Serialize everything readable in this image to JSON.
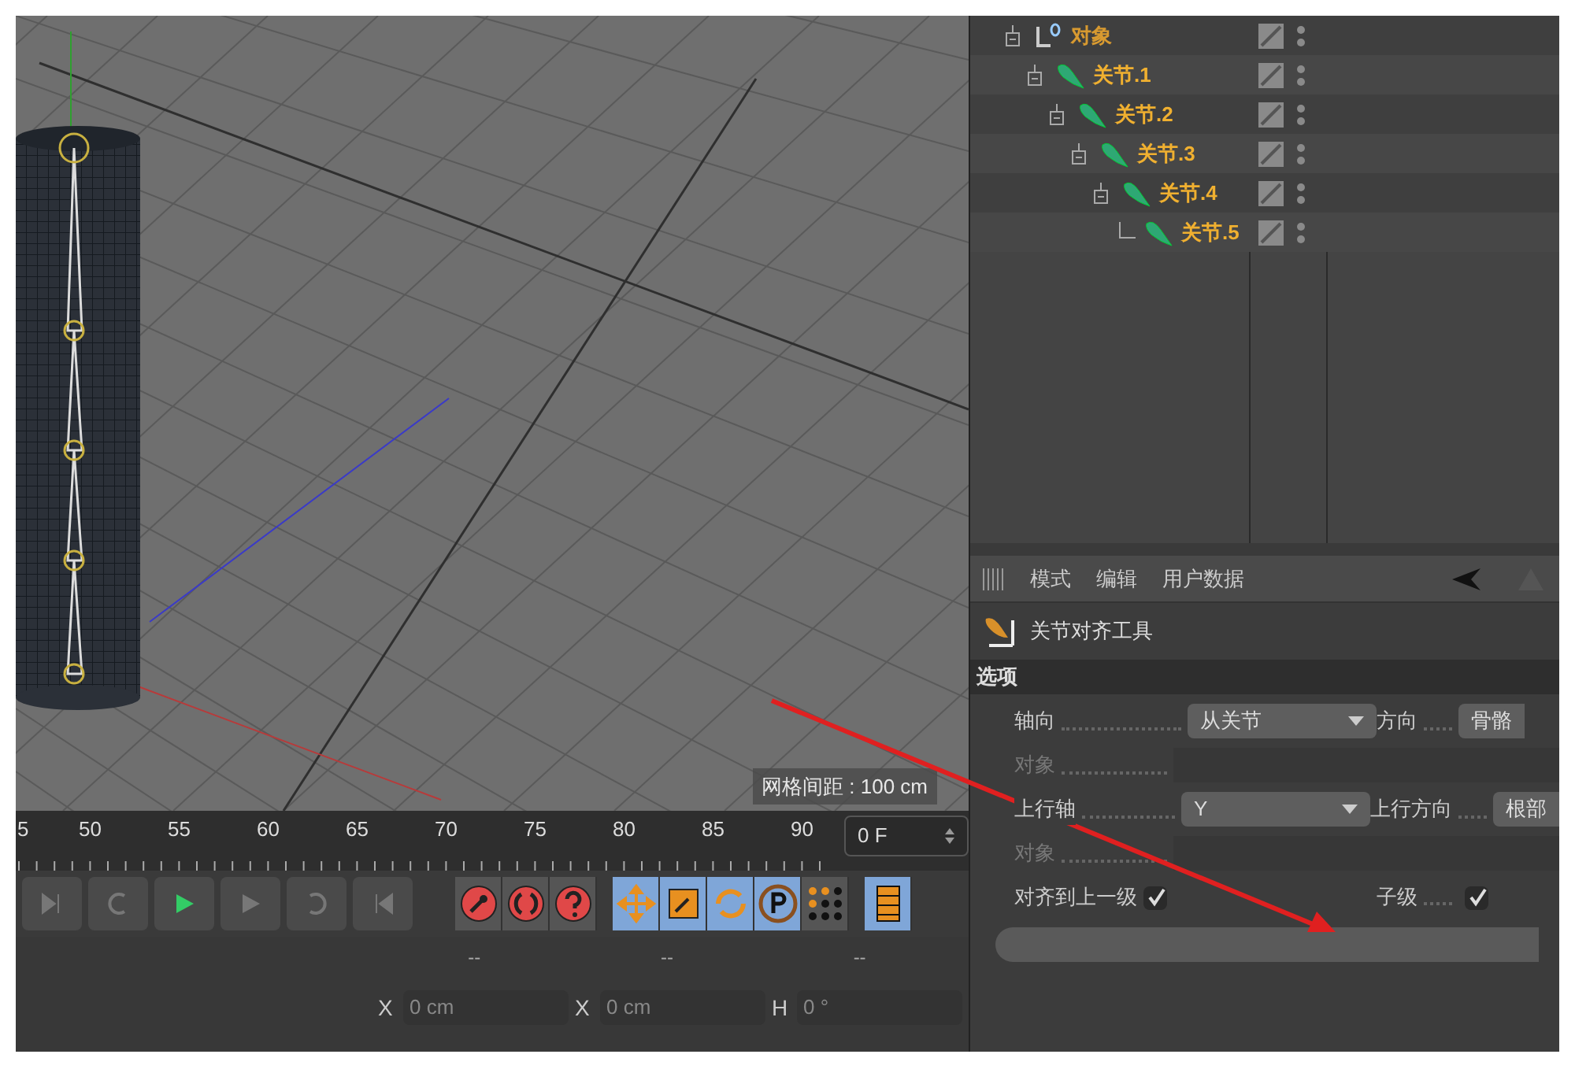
{
  "viewport": {
    "grid_label": "网格间距 : 100 cm"
  },
  "timeline": {
    "ticks": [
      "5",
      "50",
      "55",
      "60",
      "65",
      "70",
      "75",
      "80",
      "85",
      "90"
    ],
    "frame": "0 F"
  },
  "toolbar": [
    {
      "kind": "key",
      "selected": false
    },
    {
      "kind": "cycle",
      "selected": false
    },
    {
      "kind": "help",
      "selected": false
    },
    {
      "kind": "move",
      "selected": true
    },
    {
      "kind": "scale",
      "selected": true
    },
    {
      "kind": "rotate",
      "selected": true
    },
    {
      "kind": "param",
      "selected": true
    },
    {
      "kind": "points",
      "selected": false
    },
    {
      "kind": "film",
      "selected": true
    }
  ],
  "coordinates": {
    "headers": [
      "--",
      "--",
      "--"
    ],
    "fields": [
      {
        "axis": "X",
        "value": "0 cm"
      },
      {
        "axis": "X",
        "value": "0 cm"
      },
      {
        "axis": "H",
        "value": "0 °"
      }
    ]
  },
  "object_manager": {
    "items": [
      {
        "name": "对象",
        "kind": "null",
        "children": [
          {
            "name": "关节.1",
            "kind": "joint",
            "children": [
              {
                "name": "关节.2",
                "kind": "joint",
                "children": [
                  {
                    "name": "关节.3",
                    "kind": "joint",
                    "children": [
                      {
                        "name": "关节.4",
                        "kind": "joint",
                        "children": [
                          {
                            "name": "关节.5",
                            "kind": "joint"
                          }
                        ]
                      }
                    ]
                  }
                ]
              }
            ]
          }
        ]
      }
    ]
  },
  "attributes": {
    "menu": [
      "模式",
      "编辑",
      "用户数据"
    ],
    "tool_name": "关节对齐工具",
    "section": "选项",
    "rows": [
      [
        {
          "label": "轴向",
          "kind": "dropdown",
          "value": "从关节",
          "disabled": false
        },
        {
          "label": "方向",
          "kind": "button",
          "value": "骨骼",
          "disabled": false
        }
      ],
      [
        {
          "label": "对象",
          "kind": "link",
          "disabled": true
        }
      ],
      [
        {
          "label": "上行轴",
          "kind": "dropdown",
          "value": "Y",
          "disabled": false
        },
        {
          "label": "上行方向",
          "kind": "button",
          "value": "根部",
          "disabled": false
        }
      ],
      [
        {
          "label": "对象",
          "kind": "link",
          "disabled": true
        }
      ],
      [
        {
          "label": "对齐到上一级",
          "kind": "checkbox",
          "checked": true,
          "disabled": false
        },
        {
          "label": "子级",
          "kind": "checkbox",
          "checked": true,
          "disabled": false
        }
      ]
    ]
  }
}
